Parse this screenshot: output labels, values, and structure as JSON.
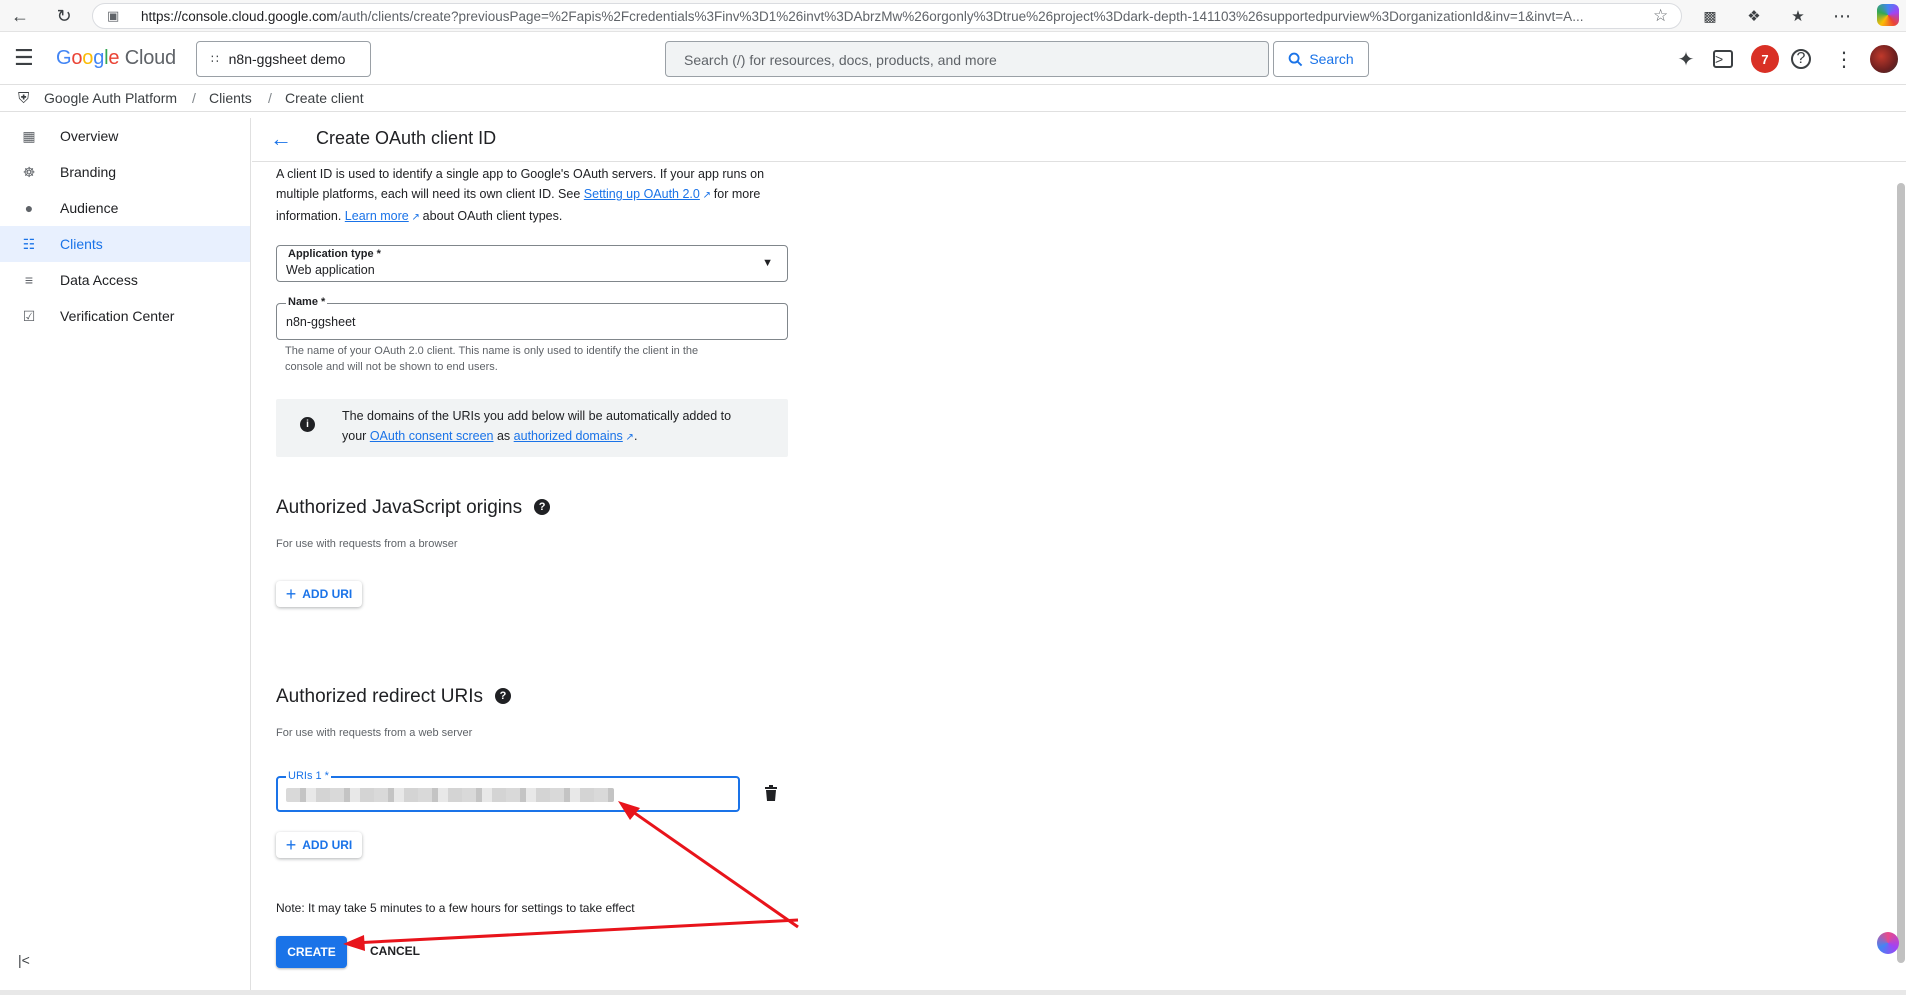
{
  "browser": {
    "url_host": "https://console.cloud.google.com",
    "url_rest": "/auth/clients/create?previousPage=%2Fapis%2Fcredentials%3Finv%3D1%26invt%3DAbrzMw%26orgonly%3Dtrue%26project%3Ddark-depth-141103%26supportedpurview%3DorganizationId&inv=1&invt=A..."
  },
  "header": {
    "logo_g": "Google",
    "logo_cloud": "Cloud",
    "project_name": "n8n-ggsheet demo",
    "search_placeholder": "Search (/) for resources, docs, products, and more",
    "search_button": "Search",
    "notification_count": "7"
  },
  "breadcrumb": {
    "root": "Google Auth Platform",
    "sep1": "/",
    "clients": "Clients",
    "sep2": "/",
    "current": "Create client"
  },
  "sidebar": {
    "items": [
      {
        "label": "Overview",
        "icon": "dashboard-icon"
      },
      {
        "label": "Branding",
        "icon": "palette-icon"
      },
      {
        "label": "Audience",
        "icon": "person-icon"
      },
      {
        "label": "Clients",
        "icon": "grid-icon"
      },
      {
        "label": "Data Access",
        "icon": "data-access-icon"
      },
      {
        "label": "Verification Center",
        "icon": "verification-icon"
      }
    ],
    "active_index": 3
  },
  "page": {
    "title": "Create OAuth client ID",
    "intro_1": "A client ID is used to identify a single app to Google's OAuth servers. If your app runs on",
    "intro_2a": "multiple platforms, each will need its own client ID. See",
    "intro_link1": "Setting up OAuth 2.0",
    "intro_2b": "for more",
    "intro_3a": "information.",
    "intro_link2": "Learn more",
    "intro_3b": "about OAuth client types.",
    "app_type_label": "Application type *",
    "app_type_value": "Web application",
    "name_label": "Name *",
    "name_value": "n8n-ggsheet",
    "name_helper_1": "The name of your OAuth 2.0 client. This name is only used to identify the client in the",
    "name_helper_2": "console and will not be shown to end users.",
    "info_1": "The domains of the URIs you add below will be automatically added to",
    "info_2a": "your",
    "info_link1": "OAuth consent screen",
    "info_2b": "as",
    "info_link2": "authorized domains",
    "info_2c": ".",
    "js_origins_title": "Authorized JavaScript origins",
    "js_origins_sub": "For use with requests from a browser",
    "add_uri": "ADD URI",
    "redirect_title": "Authorized redirect URIs",
    "redirect_sub": "For use with requests from a web server",
    "uri_label": "URIs 1 *",
    "note": "Note: It may take 5 minutes to a few hours for settings to take effect",
    "create_button": "CREATE",
    "cancel_button": "CANCEL"
  },
  "colors": {
    "accent": "#1a73e8",
    "annotation_arrow": "#e8141b",
    "active_nav_bg": "#e8f0fe"
  }
}
